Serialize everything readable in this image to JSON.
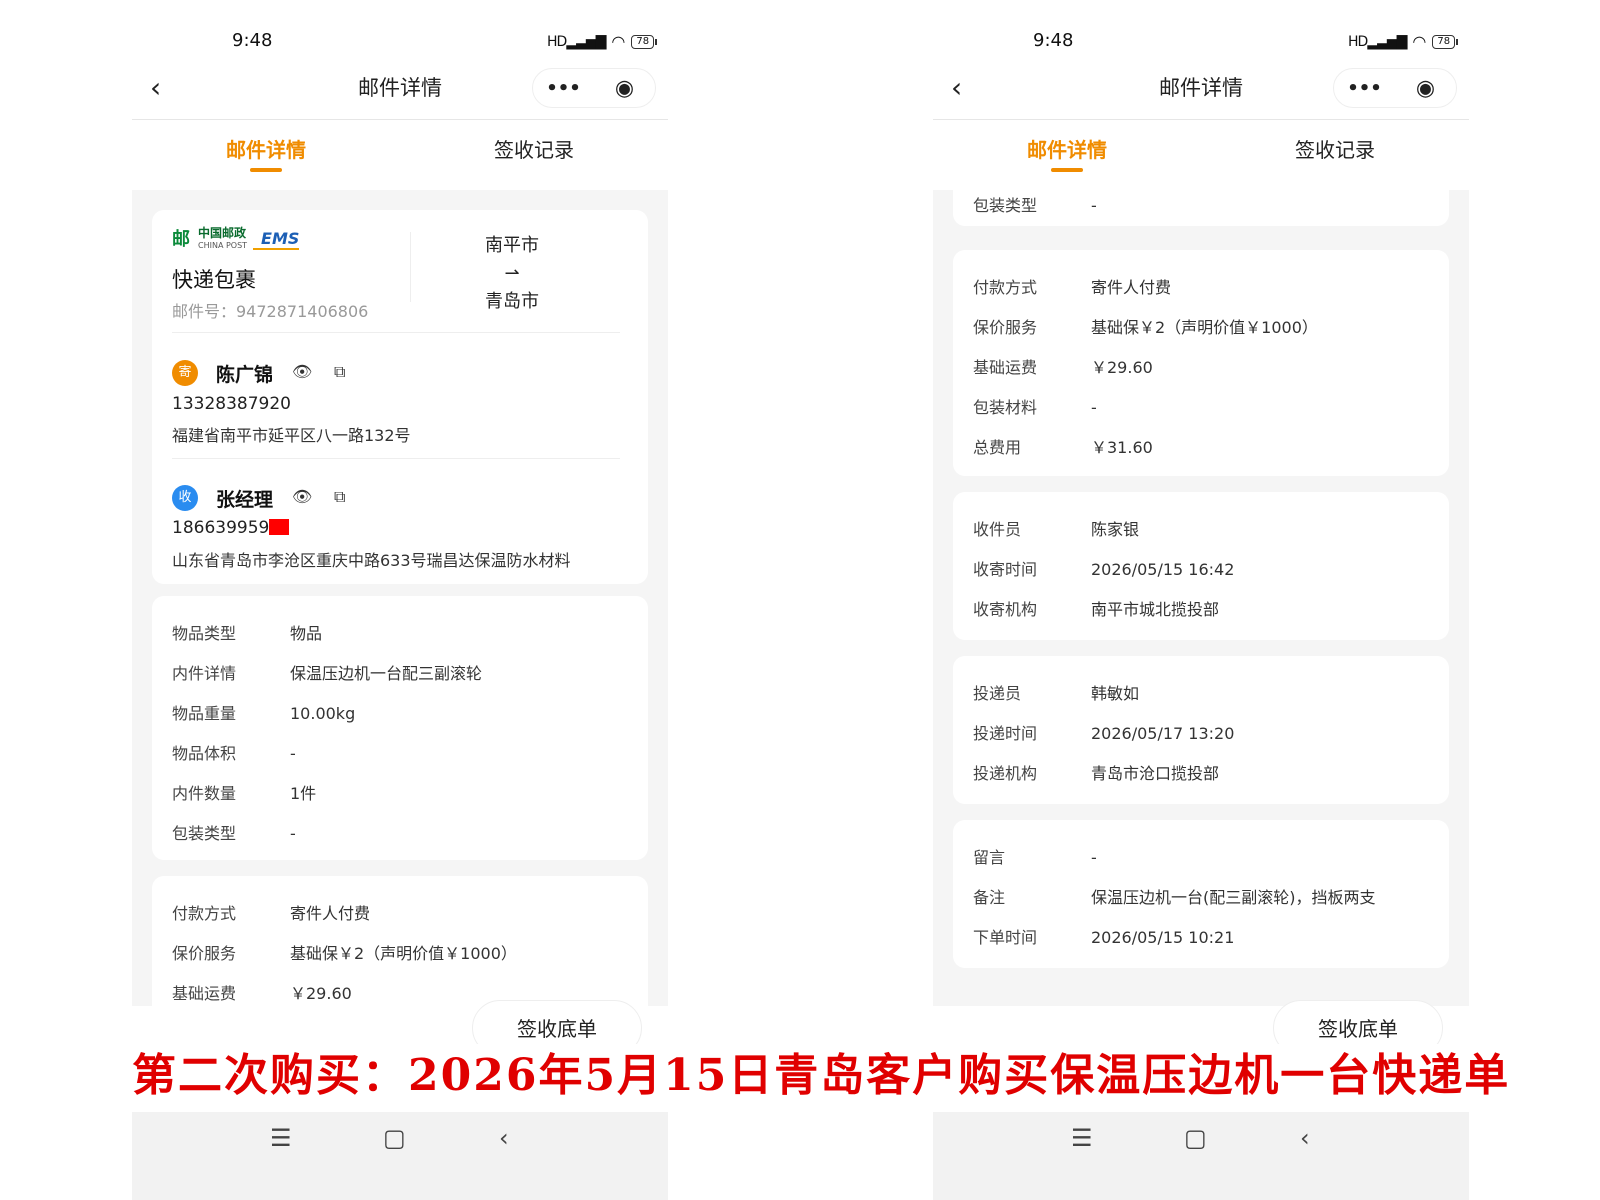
{
  "caption": "第二次购买：2026年5月15日青岛客户购买保温压边机一台快递单",
  "status": {
    "time": "9:48",
    "signal": "HD",
    "battery": "78"
  },
  "nav": {
    "back_icon": "‹",
    "title": "邮件详情",
    "more_icon": "•••",
    "close_icon": "◉"
  },
  "tabs": {
    "detail": "邮件详情",
    "record": "签收记录"
  },
  "mail": {
    "logo_cn": "中国邮政",
    "logo_en": "CHINA POST",
    "ems": "EMS",
    "type": "快递包裹",
    "number": "邮件号：9472871406806",
    "from_city": "南平市",
    "arrow": "⇀",
    "to_city": "青岛市"
  },
  "sender": {
    "badge": "寄",
    "name": "陈广锦",
    "phone": "13328387920",
    "address": "福建省南平市延平区八一路132号"
  },
  "receiver": {
    "badge": "收",
    "name": "张经理",
    "phone": "186639959",
    "address": "山东省青岛市李沧区重庆中路633号瑞昌达保温防水材料"
  },
  "goods": [
    {
      "k": "物品类型",
      "v": "物品"
    },
    {
      "k": "内件详情",
      "v": "保温压边机一台配三副滚轮"
    },
    {
      "k": "物品重量",
      "v": "10.00kg"
    },
    {
      "k": "物品体积",
      "v": "-"
    },
    {
      "k": "内件数量",
      "v": "1件"
    },
    {
      "k": "包装类型",
      "v": "-"
    }
  ],
  "payment": [
    {
      "k": "付款方式",
      "v": "寄件人付费"
    },
    {
      "k": "保价服务",
      "v": "基础保￥2（声明价值￥1000）"
    },
    {
      "k": "基础运费",
      "v": "￥29.60"
    },
    {
      "k": "包装材料",
      "v": "-"
    },
    {
      "k": "总费用",
      "v": "￥31.60"
    }
  ],
  "pickup": [
    {
      "k": "收件员",
      "v": "陈家银"
    },
    {
      "k": "收寄时间",
      "v": "2026/05/15 16:42"
    },
    {
      "k": "收寄机构",
      "v": "南平市城北揽投部"
    }
  ],
  "delivery": [
    {
      "k": "投递员",
      "v": "韩敏如"
    },
    {
      "k": "投递时间",
      "v": "2026/05/17 13:20"
    },
    {
      "k": "投递机构",
      "v": "青岛市沧口揽投部"
    }
  ],
  "notes": [
    {
      "k": "留言",
      "v": "-"
    },
    {
      "k": "备注",
      "v": "保温压边机一台(配三副滚轮)，挡板两支"
    },
    {
      "k": "下单时间",
      "v": "2026/05/15 10:21"
    }
  ],
  "signed_button": "签收底单",
  "icons": {
    "eye": "👁",
    "copy": "⧉",
    "menu": "☰",
    "home": "▢",
    "back": "‹"
  },
  "colors": {
    "accent": "#f08c00",
    "caption": "#e00000",
    "recv": "#2a8cf0"
  }
}
